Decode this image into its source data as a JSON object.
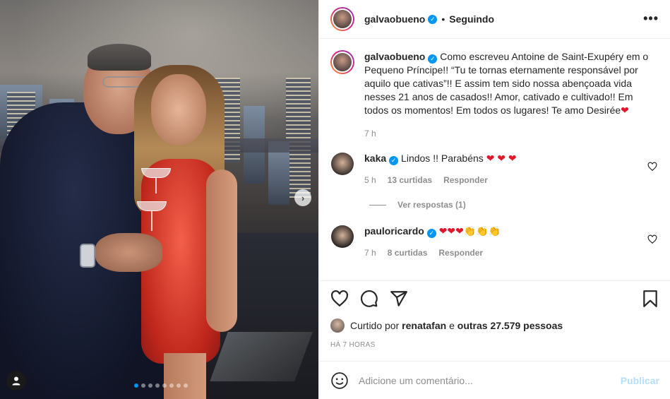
{
  "post": {
    "author": "galvaobueno",
    "follow_status": "Seguindo",
    "bullet": "•",
    "more_label": "•••",
    "caption": "Como escreveu Antoine de Saint-Exupéry em o Pequeno Príncipe!! “Tu te tornas eternamente responsável por aquilo que cativas”!! E assim tem sido nossa abençoada vida nesses 21 anos de casados!! Amor, cativado e cultivado!! Em todos os momentos! Em todos os lugares! Te amo Desirée",
    "caption_emoji": "❤",
    "caption_time": "7 h"
  },
  "carousel": {
    "next_arrow": "›",
    "dot_count": 8,
    "active_index": 0
  },
  "comments": [
    {
      "user": "kaka",
      "text": "Lindos !! Parabéns",
      "emoji": "❤ ❤ ❤",
      "time": "5 h",
      "likes": "13 curtidas",
      "reply": "Responder",
      "view_replies": "Ver respostas (1)"
    },
    {
      "user": "pauloricardo",
      "text": "",
      "emoji_red": "❤❤❤",
      "emoji_clap": "👏👏👏",
      "time": "7 h",
      "likes": "8 curtidas",
      "reply": "Responder"
    }
  ],
  "likes": {
    "prefix": "Curtido por",
    "user": "renatafan",
    "middle": "e",
    "others": "outras 27.579 pessoas"
  },
  "time_ago": "HÁ 7 HORAS",
  "add_comment": {
    "placeholder": "Adicione um comentário...",
    "publish": "Publicar"
  },
  "colors": {
    "verified": "#0095f6",
    "heart": "#e0162b",
    "publish_disabled": "#b2dffc"
  }
}
